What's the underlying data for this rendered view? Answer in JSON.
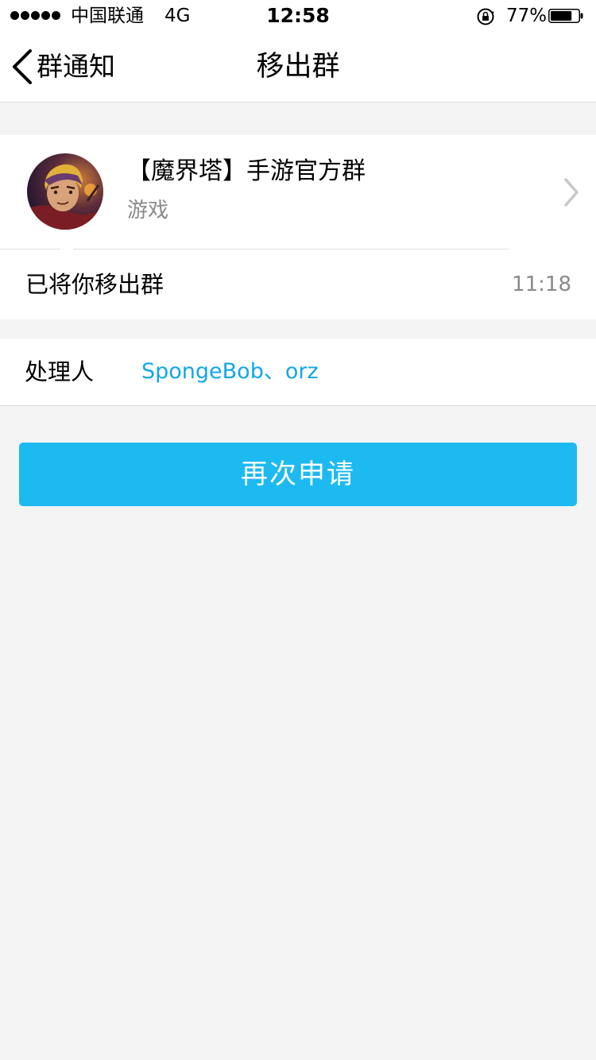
{
  "status_bar": {
    "carrier": "中国联通",
    "network": "4G",
    "time": "12:58",
    "battery_percent": "77%",
    "battery_level": 0.77
  },
  "nav": {
    "back_label": "群通知",
    "title": "移出群"
  },
  "group": {
    "name": "【魔界塔】手游官方群",
    "category": "游戏"
  },
  "message": {
    "text": "已将你移出群",
    "time": "11:18"
  },
  "handler": {
    "label": "处理人",
    "names": "SpongeBob、orz"
  },
  "actions": {
    "reapply_label": "再次申请"
  },
  "colors": {
    "accent": "#1dbaf2",
    "link": "#12a7e8",
    "secondary_text": "#8a8a8a",
    "background": "#f4f4f5"
  }
}
